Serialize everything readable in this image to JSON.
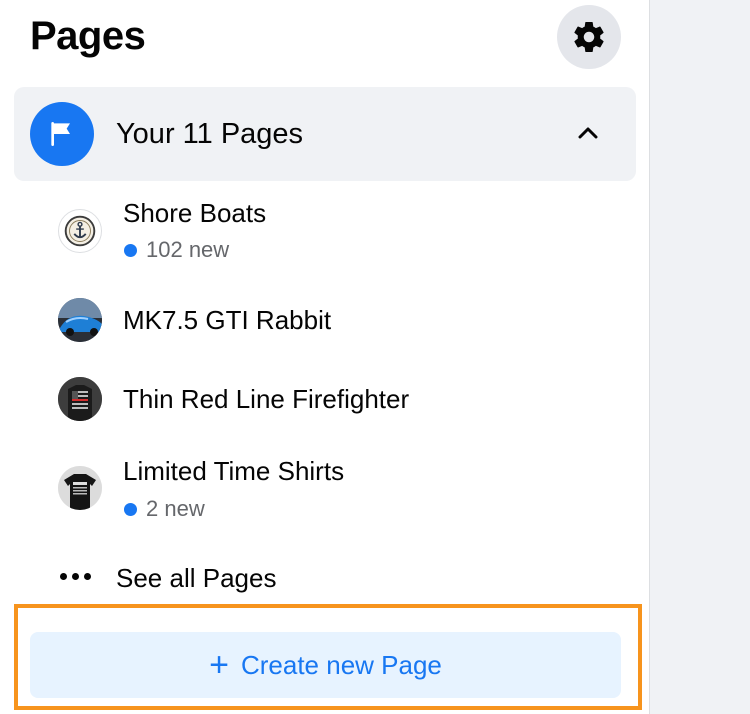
{
  "header": {
    "title": "Pages",
    "settings_icon": "gear-icon"
  },
  "section": {
    "label": "Your 11 Pages",
    "icon": "flag-icon",
    "chevron_icon": "chevron-up-icon",
    "expanded": true
  },
  "pages": [
    {
      "name": "Shore Boats",
      "badge": "102 new",
      "avatar": "anchor-logo"
    },
    {
      "name": "MK7.5 GTI Rabbit",
      "badge": "",
      "avatar": "blue-car-photo"
    },
    {
      "name": "Thin Red Line Firefighter",
      "badge": "",
      "avatar": "flag-shirt-photo"
    },
    {
      "name": "Limited Time Shirts",
      "badge": "2 new",
      "avatar": "black-shirt-photo"
    }
  ],
  "see_all": {
    "label": "See all Pages",
    "icon": "more-dots-icon"
  },
  "create": {
    "label": "Create new Page",
    "icon": "plus-icon"
  },
  "colors": {
    "accent": "#1877f2",
    "highlight_border": "#f7941d",
    "button_bg": "#e7f3ff",
    "section_bg": "#f0f2f5"
  }
}
